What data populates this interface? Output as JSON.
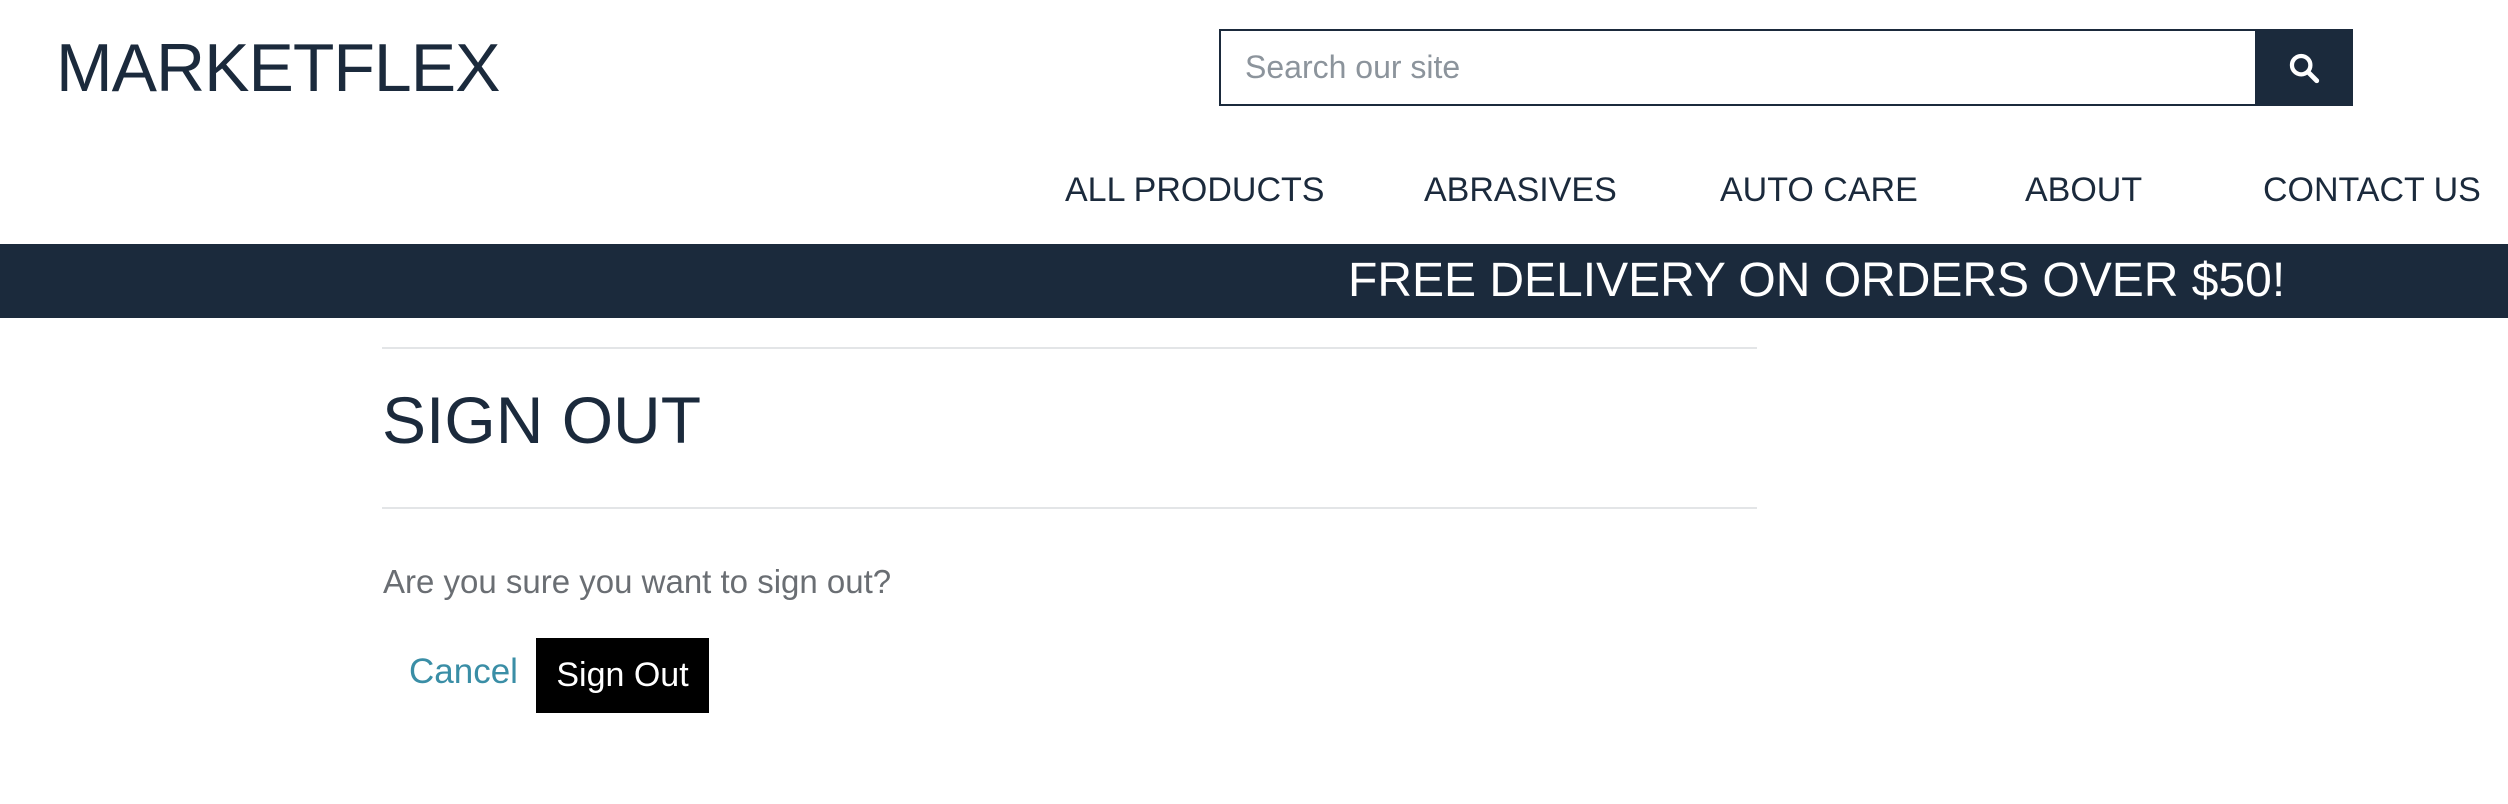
{
  "header": {
    "logo": "MARKETFLEX",
    "search": {
      "placeholder": "Search our site",
      "value": "",
      "button_icon": "search-icon"
    }
  },
  "nav": {
    "items": [
      {
        "label": "ALL PRODUCTS"
      },
      {
        "label": "ABRASIVES"
      },
      {
        "label": "AUTO CARE"
      },
      {
        "label": "ABOUT"
      },
      {
        "label": "CONTACT US"
      }
    ]
  },
  "promo": {
    "text": "FREE DELIVERY ON ORDERS OVER $50!"
  },
  "main": {
    "title": "SIGN OUT",
    "message": "Are you sure you want to sign out?",
    "cancel_label": "Cancel",
    "signout_label": "Sign Out"
  },
  "colors": {
    "brand_dark": "#1b2a3c",
    "link": "#3a8ea6",
    "button_bg": "#000000"
  }
}
